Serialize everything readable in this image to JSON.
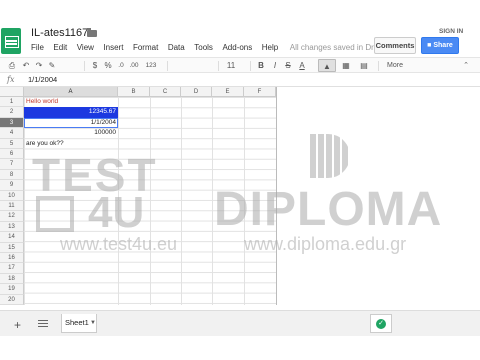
{
  "header": {
    "doc_title": "IL-ates1167",
    "sign_in": "SIGN IN",
    "comments_label": "Comments",
    "share_label": "Share",
    "save_status": "All changes saved in Drive"
  },
  "menu": [
    "File",
    "Edit",
    "View",
    "Insert",
    "Format",
    "Data",
    "Tools",
    "Add-ons",
    "Help"
  ],
  "toolbar": {
    "currency": "$",
    "percent": "%",
    "decimal_less": ".0",
    "decimal_more": ".00",
    "more_formats": "123",
    "font_size": "11",
    "bold": "B",
    "italic": "I",
    "strike": "S",
    "text_color": "A",
    "more": "More"
  },
  "formula_bar": {
    "fx": "fx",
    "value": "1/1/2004"
  },
  "grid": {
    "columns": [
      "A",
      "B",
      "C",
      "D",
      "E",
      "F"
    ],
    "rows": [
      "1",
      "2",
      "3",
      "4",
      "5",
      "6",
      "7",
      "8",
      "9",
      "10",
      "11",
      "12",
      "13",
      "14",
      "15",
      "16",
      "17",
      "18",
      "19",
      "20"
    ],
    "cells": {
      "a1": "Hello world",
      "a2": "12345.67",
      "a3": "1/1/2004",
      "a4": "100000",
      "a5": "are you ok??"
    },
    "selected_cell": "A3",
    "colors": {
      "a1_text": "#c0392b",
      "a2_fill": "#1c39e0"
    }
  },
  "watermark": {
    "test_line1": "TEST",
    "test_line2": "4U",
    "test_url": "www.test4u.eu",
    "diploma": "DIPLOMA",
    "diploma_url": "www.diploma.edu.gr"
  },
  "sheets": {
    "add_label": "+",
    "tab_label": "Sheet1"
  }
}
